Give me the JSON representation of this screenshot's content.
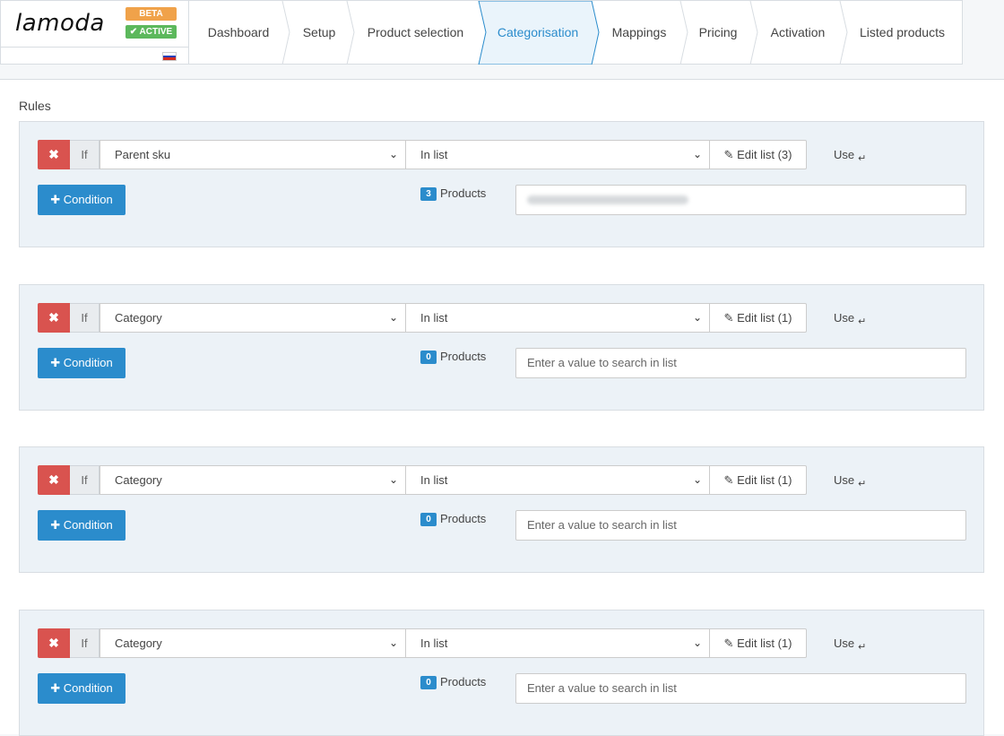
{
  "brand": {
    "name": "lamoda",
    "badge_beta": "BETA",
    "badge_active": "✔ ACTIVE",
    "flag": "russia-flag"
  },
  "nav": {
    "steps": [
      "Dashboard",
      "Setup",
      "Product selection",
      "Categorisation",
      "Mappings",
      "Pricing",
      "Activation",
      "Listed products"
    ],
    "active": "Categorisation"
  },
  "rules_title": "Rules",
  "rules": [
    {
      "delete": "✖",
      "if": "If",
      "field": "Parent sku",
      "operator": "In list",
      "edit": "Edit list (3)",
      "use": "Use",
      "condition": "Condition",
      "count": "3",
      "count_label": "Products",
      "search_value": "",
      "search_placeholder": "Enter a value to search in list",
      "search_blurred": true
    },
    {
      "delete": "✖",
      "if": "If",
      "field": "Category",
      "operator": "In list",
      "edit": "Edit list (1)",
      "use": "Use",
      "condition": "Condition",
      "count": "0",
      "count_label": "Products",
      "search_value": "",
      "search_placeholder": "Enter a value to search in list",
      "search_blurred": false
    },
    {
      "delete": "✖",
      "if": "If",
      "field": "Category",
      "operator": "In list",
      "edit": "Edit list (1)",
      "use": "Use",
      "condition": "Condition",
      "count": "0",
      "count_label": "Products",
      "search_value": "",
      "search_placeholder": "Enter a value to search in list",
      "search_blurred": false
    },
    {
      "delete": "✖",
      "if": "If",
      "field": "Category",
      "operator": "In list",
      "edit": "Edit list (1)",
      "use": "Use",
      "condition": "Condition",
      "count": "0",
      "count_label": "Products",
      "search_value": "",
      "search_placeholder": "Enter a value to search in list",
      "search_blurred": false
    }
  ],
  "colors": {
    "accent": "#2b8ccc",
    "danger": "#d9534f",
    "beta": "#f0a24a",
    "active": "#5cb85c",
    "rule_bg": "#ecf2f7"
  }
}
